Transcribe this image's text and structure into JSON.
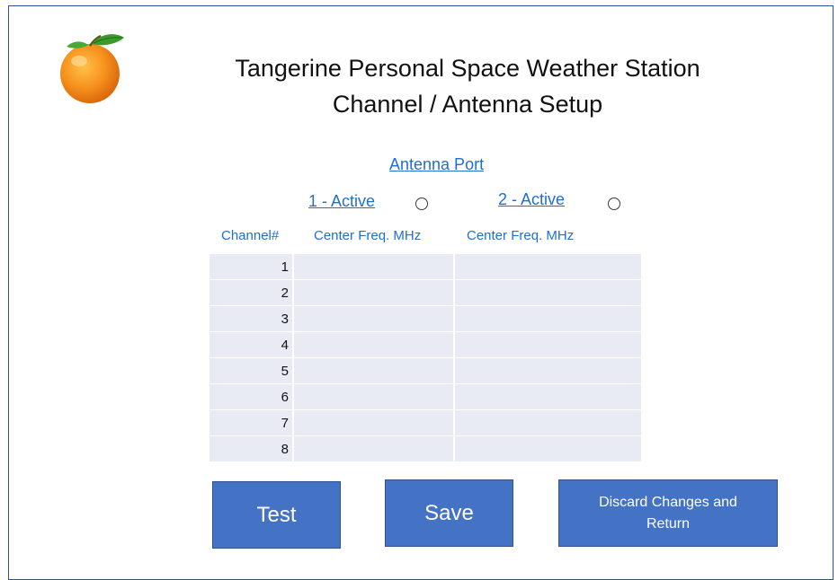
{
  "header": {
    "title_line1": "Tangerine Personal Space Weather Station",
    "title_line2": "Channel / Antenna Setup"
  },
  "antenna": {
    "section_label": "Antenna Port",
    "port1_label": "1 - Active",
    "port2_label": "2 - Active"
  },
  "table": {
    "headers": [
      "Channel#",
      "Center Freq. MHz",
      "Center Freq. MHz"
    ],
    "rows": [
      {
        "channel": "1",
        "freq1": "",
        "freq2": ""
      },
      {
        "channel": "2",
        "freq1": "",
        "freq2": ""
      },
      {
        "channel": "3",
        "freq1": "",
        "freq2": ""
      },
      {
        "channel": "4",
        "freq1": "",
        "freq2": ""
      },
      {
        "channel": "5",
        "freq1": "",
        "freq2": ""
      },
      {
        "channel": "6",
        "freq1": "",
        "freq2": ""
      },
      {
        "channel": "7",
        "freq1": "",
        "freq2": ""
      },
      {
        "channel": "8",
        "freq1": "",
        "freq2": ""
      }
    ]
  },
  "buttons": {
    "test": "Test",
    "save": "Save",
    "discard": "Discard Changes and Return"
  },
  "colors": {
    "accent": "#4472c4",
    "link": "#1f6fd0",
    "cell_bg": "#e8ebf4",
    "frame": "#2f4f9f"
  },
  "icons": {
    "logo": "tangerine-icon"
  }
}
